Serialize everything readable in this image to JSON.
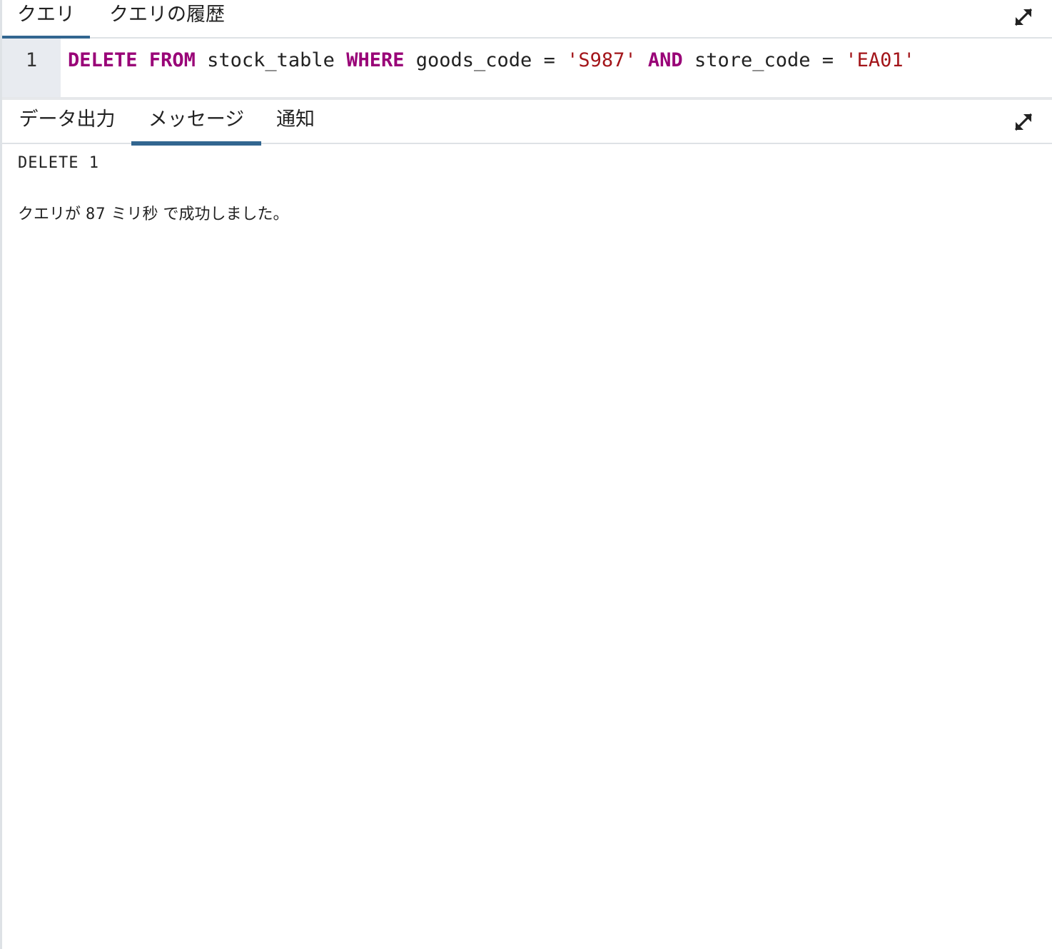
{
  "top_tabs": {
    "query_label": "クエリ",
    "history_label": "クエリの履歴",
    "active": "query"
  },
  "editor": {
    "line_number": "1",
    "tokens": {
      "delete": "DELETE",
      "from": "FROM",
      "table": "stock_table",
      "where": "WHERE",
      "col1": "goods_code",
      "eq1": "=",
      "val1": "'S987'",
      "and": "AND",
      "col2": "store_code",
      "eq2": "=",
      "val2": "'EA01'"
    }
  },
  "bottom_tabs": {
    "data_output_label": "データ出力",
    "messages_label": "メッセージ",
    "notifications_label": "通知",
    "active": "messages"
  },
  "messages": {
    "result_line": "DELETE 1",
    "success_prefix": "クエリが",
    "duration": "87",
    "unit": "ミリ秒",
    "success_suffix": "で成功しました。"
  },
  "icons": {
    "expand": "expand-arrows-icon"
  },
  "colors": {
    "accent": "#326690",
    "keyword": "#990077",
    "string": "#a3151a",
    "gutter_bg": "#e8ebf0"
  }
}
